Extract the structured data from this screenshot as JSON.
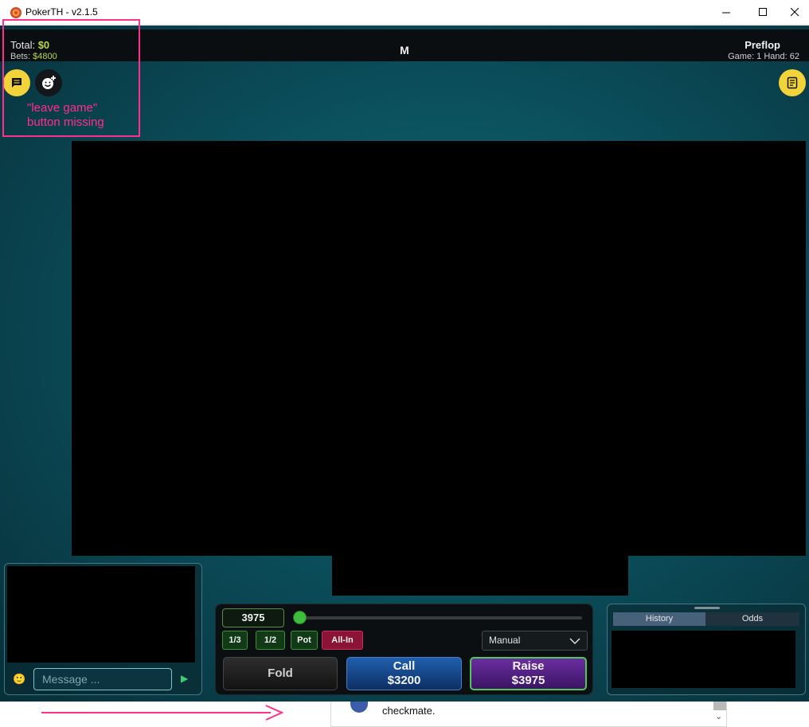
{
  "window": {
    "title": "PokerTH - v2.1.5"
  },
  "topbar": {
    "total_label": "Total:",
    "total_value": "$0",
    "bets_label": "Bets:",
    "bets_value": "$4800",
    "center_label": "M",
    "round": "Preflop",
    "game_hand": "Game: 1  Hand: 62"
  },
  "annotation": {
    "text": "\"leave game\" button missing"
  },
  "chat": {
    "placeholder": "Message ..."
  },
  "action": {
    "bet_amount": "3975",
    "slider_fraction": 0,
    "presets": [
      "1/3",
      "1/2",
      "Pot",
      "All-In"
    ],
    "mode": "Manual",
    "fold": "Fold",
    "call_label": "Call",
    "call_amount": "$3200",
    "raise_label": "Raise",
    "raise_amount": "$3975"
  },
  "history": {
    "tabs": [
      "History",
      "Odds"
    ]
  },
  "bottom": {
    "tweet_text": "checkmate."
  },
  "colors": {
    "accent_green": "#b7d84a",
    "annotation": "#ff2f8c",
    "yellow": "#f3d33a"
  }
}
